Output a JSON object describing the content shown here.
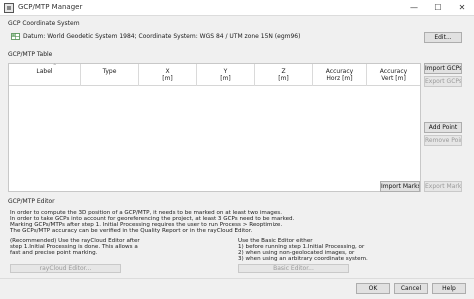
{
  "window": {
    "title": "GCP/MTP Manager",
    "minimize": "—",
    "maximize": "☐",
    "close": "✕"
  },
  "coordinate_system": {
    "label": "GCP Coordinate System",
    "datum": "Datum: World Geodetic System 1984; Coordinate System: WGS 84 / UTM zone 15N (egm96)",
    "edit_button": "Edit..."
  },
  "table": {
    "label": "GCP/MTP Table",
    "columns": [
      {
        "line1": "Label",
        "line2": ""
      },
      {
        "line1": "Type",
        "line2": ""
      },
      {
        "line1": "X",
        "line2": "[m]"
      },
      {
        "line1": "Y",
        "line2": "[m]"
      },
      {
        "line1": "Z",
        "line2": "[m]"
      },
      {
        "line1": "Accuracy",
        "line2": "Horz [m]"
      },
      {
        "line1": "Accuracy",
        "line2": "Vert [m]"
      }
    ],
    "sort_indicator": "^",
    "import_gcps": "Import GCPs...",
    "export_gcps": "Export GCPs...",
    "add_point": "Add Point",
    "remove_points": "Remove Points",
    "import_marks": "Import Marks...",
    "export_marks": "Export Marks..."
  },
  "editor": {
    "label": "GCP/MTP Editor",
    "desc": [
      "In order to compute the 3D position of a GCP/MTP, it needs to be marked on at least two images.",
      "In order to take GCPs into account for georeferencing the project, at least 3 GCPs need to be marked.",
      "Marking GCPs/MTPs after step 1. Initial Processing requires the user to run Process > Reoptimize.",
      "The GCPs/MTP accuracy can be verified in the Quality Report or in the rayCloud Editor."
    ],
    "raycloud_desc": [
      "(Recommended) Use the rayCloud Editor after",
      "step 1.Initial Processing is done. This allows a",
      "fast and precise point marking."
    ],
    "basic_desc": [
      "Use the Basic Editor either",
      "1) before running step 1.Initial Processing, or",
      "2) when using non-geolocated images, or",
      "3) when using an arbitrary coordinate system."
    ],
    "raycloud_button": "rayCloud Editor...",
    "basic_button": "Basic Editor..."
  },
  "footer": {
    "ok": "OK",
    "cancel": "Cancel",
    "help": "Help"
  }
}
